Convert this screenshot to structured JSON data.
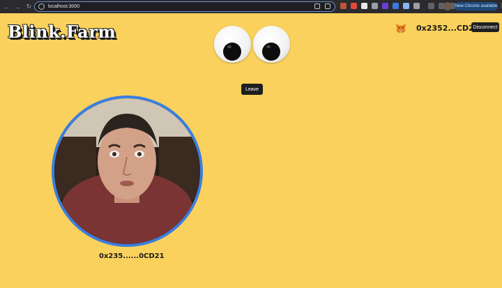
{
  "browser": {
    "url": "localhost:3000",
    "update_label": "New Chrome available",
    "extension_colors": [
      "#c0543b",
      "#e34a3c",
      "#e8e8e8",
      "#9aa0a6",
      "#6b3fd6",
      "#3a7ae0",
      "#8ab4f8",
      "#9aa0a6"
    ]
  },
  "app": {
    "logo": "Blink.Farm",
    "wallet_address": "0x2352...CD21",
    "disconnect_label": "Disconnect",
    "leave_label": "Leave",
    "participant_address": "0x235......0CD21"
  },
  "colors": {
    "background": "#f9d15c",
    "video_ring": "#3a7fe0",
    "button_dark": "#1f1f1f"
  },
  "icons": {
    "wallet": "metamask-fox-icon",
    "eyes": "googly-eyes"
  }
}
